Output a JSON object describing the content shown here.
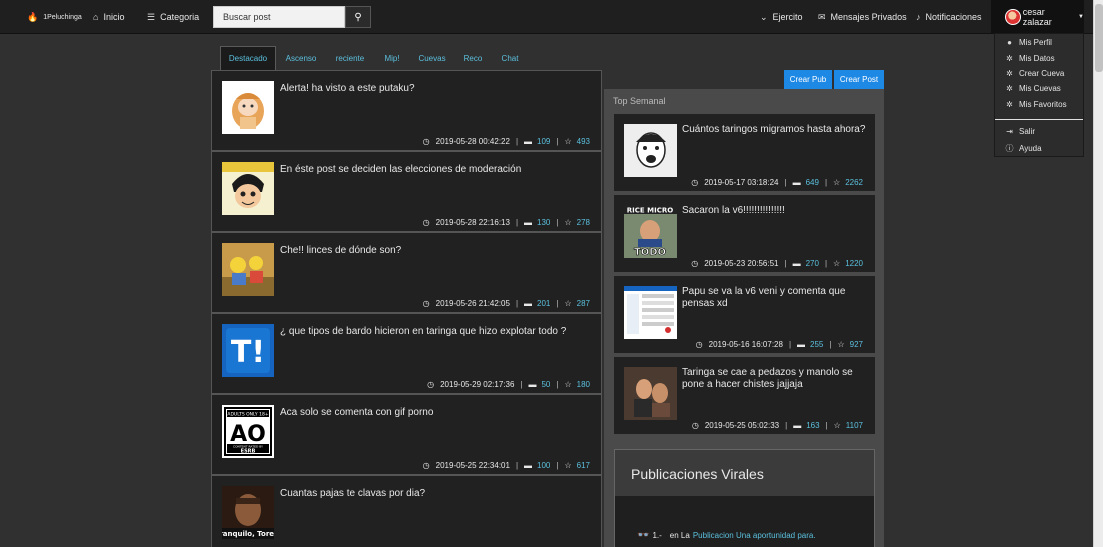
{
  "nav": {
    "brand": "1Peluchinga",
    "inicio": "Inicio",
    "categoria": "Categoria",
    "search_placeholder": "Buscar post",
    "ejercito": "Ejercito",
    "mensajes": "Mensajes Privados",
    "notificaciones": "Notificaciones",
    "user": "cesar zalazar"
  },
  "dropdown": {
    "items": [
      {
        "label": "Mis Perfil",
        "icon": "user-icon"
      },
      {
        "label": "Mis Datos",
        "icon": "gear-icon"
      },
      {
        "label": "Crear Cueva",
        "icon": "gear-icon"
      },
      {
        "label": "Mis Cuevas",
        "icon": "gear-icon"
      },
      {
        "label": "Mis Favoritos",
        "icon": "gear-icon"
      },
      {
        "label": "Salir",
        "icon": "sign-out-icon"
      },
      {
        "label": "Ayuda",
        "icon": "info-icon"
      }
    ]
  },
  "tabs": [
    "Destacado",
    "Ascenso",
    "reciente",
    "Mip!",
    "Cuevas",
    "Reco",
    "Chat"
  ],
  "feed": [
    {
      "title": "Alerta! ha visto a este putaku?",
      "date": "2019-05-28 00:42:22",
      "comments": "109",
      "favs": "493"
    },
    {
      "title": "En éste post se deciden las elecciones de moderación",
      "date": "2019-05-28 22:16:13",
      "comments": "130",
      "favs": "278"
    },
    {
      "title": "Che!! linces de dónde son?",
      "date": "2019-05-26 21:42:05",
      "comments": "201",
      "favs": "287"
    },
    {
      "title": "¿ que tipos de bardo hicieron en taringa que hizo explotar todo ?",
      "date": "2019-05-29 02:17:36",
      "comments": "50",
      "favs": "180"
    },
    {
      "title": "Aca solo se comenta con gif porno",
      "date": "2019-05-25 22:34:01",
      "comments": "100",
      "favs": "617"
    },
    {
      "title": "Cuantas pajas te clavas por dia?",
      "date": "",
      "comments": "",
      "favs": ""
    }
  ],
  "buttons": {
    "crear_pub": "Crear Pub",
    "crear_post": "Crear Post"
  },
  "top_semanal": {
    "heading": "Top Semanal",
    "items": [
      {
        "title": "Cuántos taringos migramos hasta ahora?",
        "date": "2019-05-17 03:18:24",
        "comments": "649",
        "favs": "2262"
      },
      {
        "title": "Sacaron la v6!!!!!!!!!!!!!!!",
        "date": "2019-05-23 20:56:51",
        "comments": "270",
        "favs": "1220"
      },
      {
        "title": "Papu se va la v6 veni y comenta que pensas xd",
        "date": "2019-05-16 16:07:28",
        "comments": "255",
        "favs": "927"
      },
      {
        "title": "Taringa se cae a pedazos y manolo se pone a hacer chistes jajjaja",
        "date": "2019-05-25 05:02:33",
        "comments": "163",
        "favs": "1107"
      }
    ]
  },
  "virales": {
    "heading": "Publicaciones Virales",
    "item_num": "1.-",
    "item_pre": "en La",
    "item_link": "Publicacion Una aportunidad para."
  },
  "thumb_texts": {
    "adults_only": "ADULTS ONLY 18+",
    "content_rated": "CONTENT RATED BY",
    "esrb": "ESRB",
    "tranquilo": "Tranquilo, Torett",
    "rice_micro": "RICE MICRO",
    "todo": "TODO"
  },
  "colors": {
    "accent": "#5bc0de",
    "button": "#1e88e5",
    "nav_bg": "#1f1f1f",
    "panel_bg": "#212121"
  }
}
